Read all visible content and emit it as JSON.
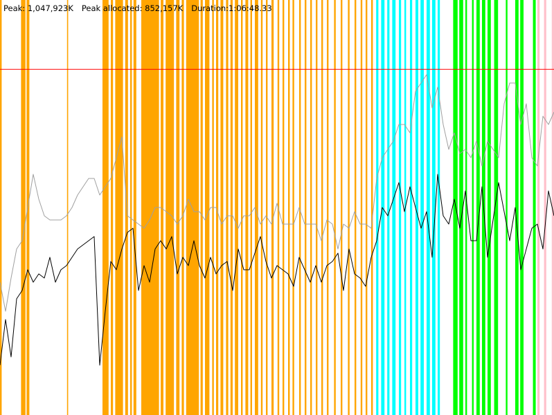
{
  "stats": {
    "peak": "Peak: 1,047,923K",
    "peak_allocated": "Peak allocated: 852,157K",
    "duration": "Duration:1:06:48.33"
  },
  "colors": {
    "background": "#ffffff",
    "threshold": "#ff0000",
    "peak_line": "#a0a0a0",
    "main_line": "#000000",
    "bands": [
      "#ffa500",
      "#00ffff",
      "#00ff00",
      "#ffc0cb"
    ]
  },
  "chart_data": {
    "type": "line",
    "title": "",
    "xlabel": "",
    "ylabel": "",
    "xlim": [
      0,
      100
    ],
    "ylim": [
      0,
      100
    ],
    "grid": false,
    "threshold": 83.3,
    "background_bands": [
      {
        "color": "#ffa500",
        "spans": [
          [
            0,
            0.3
          ],
          [
            3.8,
            4.6
          ],
          [
            4.8,
            5.3
          ],
          [
            12.1,
            12.3
          ],
          [
            18.5,
            19.6
          ],
          [
            20.0,
            20.4
          ],
          [
            20.8,
            22.2
          ],
          [
            22.6,
            23.1
          ],
          [
            23.5,
            23.8
          ],
          [
            24.1,
            24.6
          ],
          [
            25.5,
            28.7
          ],
          [
            29.0,
            29.5
          ],
          [
            29.9,
            31.4
          ],
          [
            31.8,
            32.4
          ],
          [
            32.8,
            33.2
          ],
          [
            33.6,
            35.9
          ],
          [
            36.2,
            36.6
          ],
          [
            37.0,
            37.8
          ],
          [
            38.3,
            38.6
          ],
          [
            39.0,
            39.4
          ],
          [
            39.8,
            40.3
          ],
          [
            40.8,
            41.2
          ],
          [
            41.6,
            42.0
          ],
          [
            42.4,
            43.0
          ],
          [
            43.5,
            43.8
          ],
          [
            44.3,
            44.8
          ],
          [
            45.2,
            45.5
          ],
          [
            46.0,
            46.6
          ],
          [
            47.1,
            47.4
          ],
          [
            48.0,
            48.3
          ],
          [
            49.0,
            49.4
          ],
          [
            50.1,
            50.4
          ],
          [
            51.0,
            51.3
          ],
          [
            52.0,
            52.3
          ],
          [
            52.8,
            53.1
          ],
          [
            54.0,
            54.3
          ],
          [
            55.0,
            55.3
          ],
          [
            56.0,
            56.3
          ],
          [
            57.0,
            57.3
          ],
          [
            58.0,
            58.3
          ],
          [
            59.0,
            59.3
          ],
          [
            60.3,
            60.6
          ],
          [
            61.5,
            61.8
          ],
          [
            62.8,
            63.1
          ],
          [
            64.0,
            64.3
          ],
          [
            65.1,
            65.4
          ],
          [
            66.0,
            66.3
          ],
          [
            67.0,
            67.3
          ]
        ]
      },
      {
        "color": "#00ffff",
        "spans": [
          [
            67.9,
            68.3
          ],
          [
            68.8,
            69.4
          ],
          [
            69.9,
            70.3
          ],
          [
            70.8,
            71.4
          ],
          [
            72.0,
            72.4
          ],
          [
            73.0,
            73.3
          ],
          [
            74.0,
            74.4
          ],
          [
            75.0,
            75.5
          ],
          [
            75.9,
            76.5
          ],
          [
            77.0,
            77.6
          ],
          [
            78.0,
            78.6
          ],
          [
            79.0,
            79.4
          ]
        ]
      },
      {
        "color": "#00ff00",
        "spans": [
          [
            81.8,
            82.6
          ],
          [
            82.9,
            83.6
          ],
          [
            84.0,
            84.3
          ],
          [
            85.2,
            85.5
          ],
          [
            86.0,
            86.6
          ],
          [
            87.0,
            87.6
          ],
          [
            88.0,
            88.6
          ],
          [
            89.2,
            89.9
          ],
          [
            91.3,
            91.6
          ],
          [
            93.0,
            93.6
          ],
          [
            93.9,
            94.5
          ],
          [
            96.2,
            96.7
          ]
        ]
      },
      {
        "color": "#ffc0cb",
        "spans": [
          [
            97.0,
            97.4
          ],
          [
            98.2,
            98.6
          ],
          [
            99.6,
            100
          ]
        ]
      }
    ],
    "series": [
      {
        "color": "#a0a0a0",
        "x": [
          0,
          1,
          2,
          3,
          4,
          5,
          6,
          7,
          8,
          9,
          10,
          11,
          12,
          13,
          14,
          15,
          16,
          17,
          18,
          19,
          20,
          21,
          22,
          23,
          24,
          25,
          26,
          27,
          28,
          29,
          30,
          31,
          32,
          33,
          34,
          35,
          36,
          37,
          38,
          39,
          40,
          41,
          42,
          43,
          44,
          45,
          46,
          47,
          48,
          49,
          50,
          51,
          52,
          53,
          54,
          55,
          56,
          57,
          58,
          59,
          60,
          61,
          62,
          63,
          64,
          65,
          66,
          67,
          68,
          69,
          70,
          71,
          72,
          73,
          74,
          75,
          76,
          77,
          78,
          79,
          80,
          81,
          82,
          83,
          84,
          85,
          86,
          87,
          88,
          89,
          90,
          91,
          92,
          93,
          94,
          95,
          96,
          97,
          98,
          99,
          100
        ],
        "y": [
          32,
          25,
          33,
          40,
          42,
          50,
          58,
          52,
          48,
          47,
          47,
          47,
          48,
          50,
          53,
          55,
          57,
          57,
          53,
          55,
          57,
          62,
          67,
          48,
          47,
          46,
          45,
          47,
          50,
          50,
          49,
          48,
          46,
          48,
          52,
          49,
          49,
          47,
          50,
          50,
          46,
          48,
          48,
          45,
          48,
          48,
          50,
          46,
          48,
          46,
          51,
          46,
          46,
          46,
          50,
          46,
          46,
          46,
          42,
          47,
          46,
          40,
          46,
          45,
          49,
          46,
          46,
          45,
          57,
          62,
          64,
          66,
          70,
          70,
          68,
          78,
          80,
          82,
          74,
          79,
          70,
          64,
          68,
          63,
          64,
          62,
          66,
          60,
          66,
          64,
          62,
          75,
          80,
          80,
          70,
          75,
          62,
          60,
          72,
          70,
          73
        ]
      },
      {
        "color": "#000000",
        "x": [
          0,
          1,
          2,
          3,
          4,
          5,
          6,
          7,
          8,
          9,
          10,
          11,
          12,
          13,
          14,
          15,
          16,
          17,
          18,
          19,
          20,
          21,
          22,
          23,
          24,
          25,
          26,
          27,
          28,
          29,
          30,
          31,
          32,
          33,
          34,
          35,
          36,
          37,
          38,
          39,
          40,
          41,
          42,
          43,
          44,
          45,
          46,
          47,
          48,
          49,
          50,
          51,
          52,
          53,
          54,
          55,
          56,
          57,
          58,
          59,
          60,
          61,
          62,
          63,
          64,
          65,
          66,
          67,
          68,
          69,
          70,
          71,
          72,
          73,
          74,
          75,
          76,
          77,
          78,
          79,
          80,
          81,
          82,
          83,
          84,
          85,
          86,
          87,
          88,
          89,
          90,
          91,
          92,
          93,
          94,
          95,
          96,
          97,
          98,
          99,
          100
        ],
        "y": [
          12,
          23,
          14,
          28,
          30,
          35,
          32,
          34,
          33,
          38,
          32,
          35,
          36,
          38,
          40,
          41,
          42,
          43,
          12,
          25,
          37,
          35,
          40,
          44,
          45,
          30,
          36,
          32,
          40,
          42,
          40,
          43,
          34,
          38,
          36,
          42,
          36,
          33,
          38,
          34,
          36,
          37,
          30,
          40,
          35,
          35,
          39,
          43,
          37,
          33,
          36,
          35,
          34,
          31,
          38,
          35,
          32,
          36,
          32,
          36,
          37,
          39,
          30,
          40,
          34,
          33,
          31,
          38,
          42,
          50,
          48,
          52,
          56,
          49,
          55,
          50,
          45,
          49,
          38,
          58,
          48,
          46,
          52,
          45,
          54,
          42,
          42,
          55,
          38,
          47,
          56,
          49,
          42,
          50,
          35,
          40,
          45,
          46,
          40,
          54,
          48
        ]
      }
    ]
  }
}
